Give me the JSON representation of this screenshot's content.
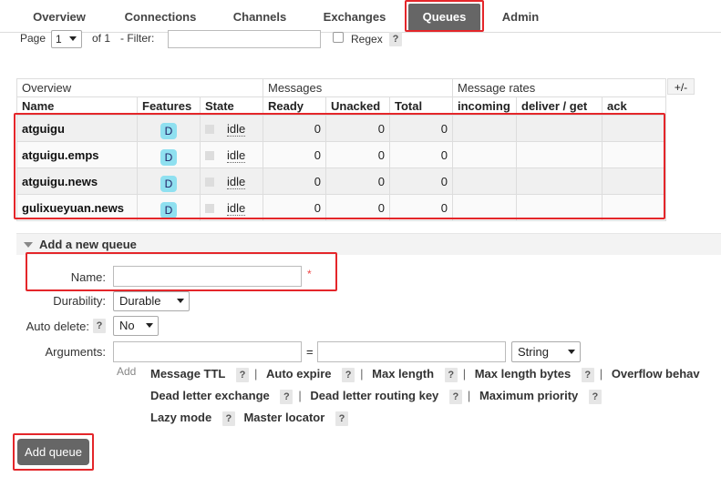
{
  "nav": {
    "tabs": [
      {
        "label": "Overview"
      },
      {
        "label": "Connections"
      },
      {
        "label": "Channels"
      },
      {
        "label": "Exchanges"
      },
      {
        "label": "Queues"
      },
      {
        "label": "Admin"
      }
    ],
    "active": "Queues"
  },
  "pagination": {
    "page_label": "Page",
    "page_value": "1",
    "of_label": "of 1",
    "filter_label": "- Filter:",
    "filter_value": "",
    "regex_label": "Regex",
    "help": "?"
  },
  "table": {
    "group_headers": {
      "overview": "Overview",
      "messages": "Messages",
      "message_rates": "Message rates"
    },
    "columns": {
      "name": "Name",
      "features": "Features",
      "state": "State",
      "ready": "Ready",
      "unacked": "Unacked",
      "total": "Total",
      "incoming": "incoming",
      "deliver_get": "deliver / get",
      "ack": "ack"
    },
    "toggle_columns": "+/-",
    "rows": [
      {
        "name": "atguigu",
        "feature": "D",
        "state": "idle",
        "ready": "0",
        "unacked": "0",
        "total": "0"
      },
      {
        "name": "atguigu.emps",
        "feature": "D",
        "state": "idle",
        "ready": "0",
        "unacked": "0",
        "total": "0"
      },
      {
        "name": "atguigu.news",
        "feature": "D",
        "state": "idle",
        "ready": "0",
        "unacked": "0",
        "total": "0"
      },
      {
        "name": "gulixueyuan.news",
        "feature": "D",
        "state": "idle",
        "ready": "0",
        "unacked": "0",
        "total": "0"
      }
    ]
  },
  "add_queue": {
    "section_title": "Add a new queue",
    "name_label": "Name:",
    "name_value": "",
    "required_mark": "*",
    "durability_label": "Durability:",
    "durability_value": "Durable",
    "auto_delete_label": "Auto delete:",
    "auto_delete_help": "?",
    "auto_delete_value": "No",
    "arguments_label": "Arguments:",
    "equals": "=",
    "arg_type_value": "String",
    "add_link": "Add",
    "arg_links_row1": [
      {
        "label": "Message TTL",
        "help": "?"
      },
      {
        "label": "Auto expire",
        "help": "?"
      },
      {
        "label": "Max length",
        "help": "?"
      },
      {
        "label": "Max length bytes",
        "help": "?"
      },
      {
        "label": "Overflow behav"
      }
    ],
    "arg_links_row2": [
      {
        "label": "Dead letter exchange",
        "help": "?"
      },
      {
        "label": "Dead letter routing key",
        "help": "?"
      },
      {
        "label": "Maximum priority",
        "help": "?"
      }
    ],
    "arg_links_row3": [
      {
        "label": "Lazy mode",
        "help": "?"
      },
      {
        "label": "Master locator",
        "help": "?"
      }
    ],
    "separator": "|",
    "submit_label": "Add queue"
  },
  "highlight_color": "#e4262a",
  "feature_badge_color": "#8fe0f0"
}
